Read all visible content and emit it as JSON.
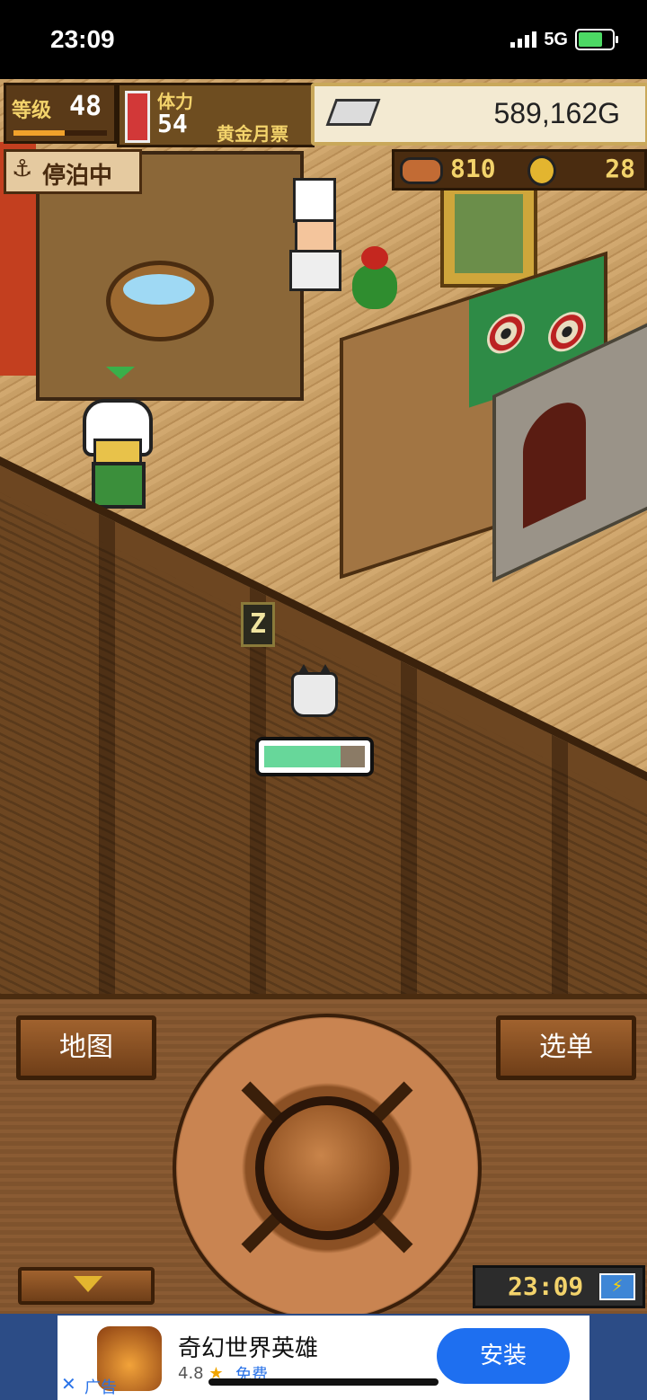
{
  "status_bar": {
    "time": "23:09",
    "network": "5G",
    "icons": [
      "signal-icon",
      "battery-charging-icon"
    ]
  },
  "hud": {
    "level_label": "等级",
    "level_value": "48",
    "level_progress": 0.55,
    "stamina_label": "体力",
    "stamina_value": "54",
    "ticket_label": "黄金月票",
    "gold": "589,162G",
    "docked_label": "停泊中",
    "food": "810",
    "medals": "28"
  },
  "game": {
    "sleep_indicator": "Z",
    "task_progress": 0.76
  },
  "controls": {
    "map_label": "地图",
    "menu_label": "选单",
    "clock": "23:09"
  },
  "ad": {
    "title": "奇幻世界英雄",
    "rating": "4.8",
    "price": "免费",
    "install_label": "安装",
    "ad_label": "广告",
    "close_glyph": "✕"
  },
  "colors": {
    "accent_gold": "#f3d36b",
    "install_blue": "#1e6ff0",
    "progress_green": "#67d79a"
  }
}
